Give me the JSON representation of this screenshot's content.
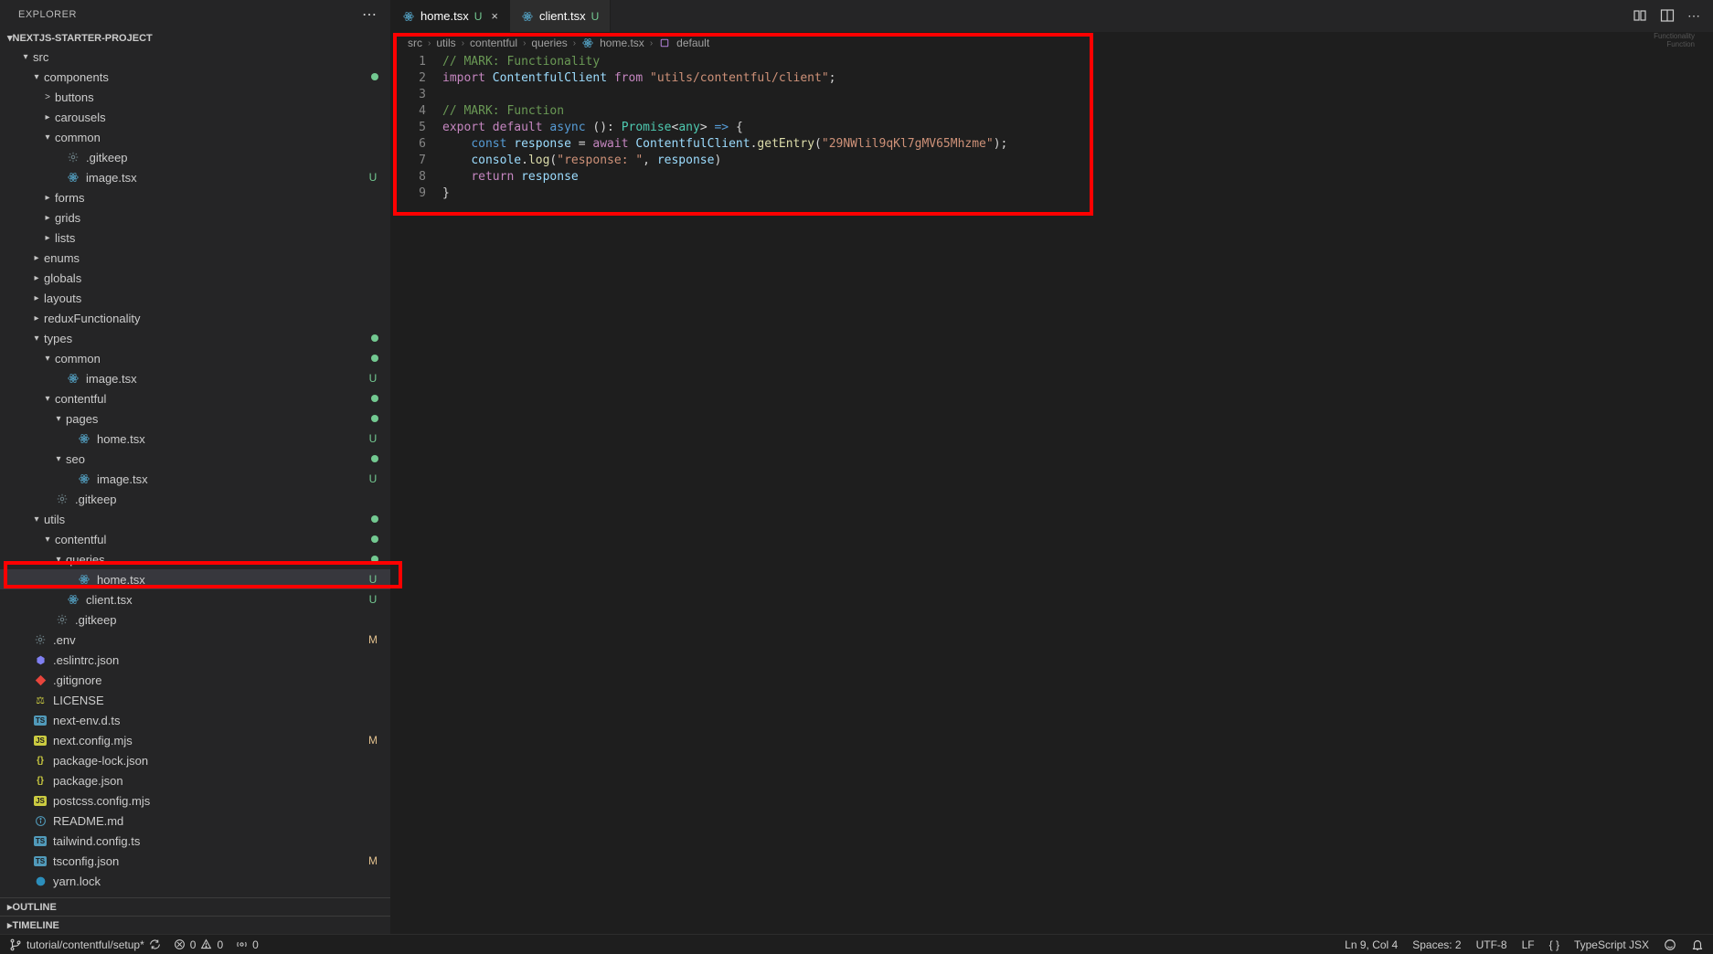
{
  "sidebar": {
    "title": "EXPLORER",
    "project": "NEXTJS-STARTER-PROJECT",
    "outline": "OUTLINE",
    "timeline": "TIMELINE",
    "tree": [
      {
        "type": "folder",
        "label": "src",
        "depth": 1,
        "open": true
      },
      {
        "type": "folder",
        "label": "components",
        "depth": 2,
        "open": true,
        "dot": true
      },
      {
        "type": "folder",
        "label": "buttons",
        "depth": 3,
        "open": false,
        "chev": ">"
      },
      {
        "type": "folder",
        "label": "carousels",
        "depth": 3,
        "open": false
      },
      {
        "type": "folder",
        "label": "common",
        "depth": 3,
        "open": true
      },
      {
        "type": "file",
        "label": ".gitkeep",
        "depth": 4,
        "icon": "gear"
      },
      {
        "type": "file",
        "label": "image.tsx",
        "depth": 4,
        "icon": "react",
        "badge": "U"
      },
      {
        "type": "folder",
        "label": "forms",
        "depth": 3,
        "open": false
      },
      {
        "type": "folder",
        "label": "grids",
        "depth": 3,
        "open": false
      },
      {
        "type": "folder",
        "label": "lists",
        "depth": 3,
        "open": false
      },
      {
        "type": "folder",
        "label": "enums",
        "depth": 2,
        "open": false
      },
      {
        "type": "folder",
        "label": "globals",
        "depth": 2,
        "open": false
      },
      {
        "type": "folder",
        "label": "layouts",
        "depth": 2,
        "open": false
      },
      {
        "type": "folder",
        "label": "reduxFunctionality",
        "depth": 2,
        "open": false
      },
      {
        "type": "folder",
        "label": "types",
        "depth": 2,
        "open": true,
        "dot": true
      },
      {
        "type": "folder",
        "label": "common",
        "depth": 3,
        "open": true,
        "dot": true
      },
      {
        "type": "file",
        "label": "image.tsx",
        "depth": 4,
        "icon": "react",
        "badge": "U"
      },
      {
        "type": "folder",
        "label": "contentful",
        "depth": 3,
        "open": true,
        "dot": true
      },
      {
        "type": "folder",
        "label": "pages",
        "depth": 4,
        "open": true,
        "dot": true
      },
      {
        "type": "file",
        "label": "home.tsx",
        "depth": 5,
        "icon": "react",
        "badge": "U"
      },
      {
        "type": "folder",
        "label": "seo",
        "depth": 4,
        "open": true,
        "dot": true
      },
      {
        "type": "file",
        "label": "image.tsx",
        "depth": 5,
        "icon": "react",
        "badge": "U"
      },
      {
        "type": "file",
        "label": ".gitkeep",
        "depth": 3,
        "icon": "gear"
      },
      {
        "type": "folder",
        "label": "utils",
        "depth": 2,
        "open": true,
        "dot": true
      },
      {
        "type": "folder",
        "label": "contentful",
        "depth": 3,
        "open": true,
        "dot": true
      },
      {
        "type": "folder",
        "label": "queries",
        "depth": 4,
        "open": true,
        "dot": true
      },
      {
        "type": "file",
        "label": "home.tsx",
        "depth": 5,
        "icon": "react",
        "badge": "U",
        "active": true,
        "highlighted": true
      },
      {
        "type": "file",
        "label": "client.tsx",
        "depth": 4,
        "icon": "react",
        "badge": "U"
      },
      {
        "type": "file",
        "label": ".gitkeep",
        "depth": 3,
        "icon": "gear"
      },
      {
        "type": "file",
        "label": ".env",
        "depth": 1,
        "icon": "gear",
        "badge": "M"
      },
      {
        "type": "file",
        "label": ".eslintrc.json",
        "depth": 1,
        "icon": "eslint"
      },
      {
        "type": "file",
        "label": ".gitignore",
        "depth": 1,
        "icon": "git"
      },
      {
        "type": "file",
        "label": "LICENSE",
        "depth": 1,
        "icon": "license"
      },
      {
        "type": "file",
        "label": "next-env.d.ts",
        "depth": 1,
        "icon": "ts"
      },
      {
        "type": "file",
        "label": "next.config.mjs",
        "depth": 1,
        "icon": "js",
        "badge": "M"
      },
      {
        "type": "file",
        "label": "package-lock.json",
        "depth": 1,
        "icon": "json"
      },
      {
        "type": "file",
        "label": "package.json",
        "depth": 1,
        "icon": "json"
      },
      {
        "type": "file",
        "label": "postcss.config.mjs",
        "depth": 1,
        "icon": "js"
      },
      {
        "type": "file",
        "label": "README.md",
        "depth": 1,
        "icon": "info"
      },
      {
        "type": "file",
        "label": "tailwind.config.ts",
        "depth": 1,
        "icon": "ts"
      },
      {
        "type": "file",
        "label": "tsconfig.json",
        "depth": 1,
        "icon": "tsconfig",
        "badge": "M"
      },
      {
        "type": "file",
        "label": "yarn.lock",
        "depth": 1,
        "icon": "yarn"
      }
    ]
  },
  "tabs": [
    {
      "label": "home.tsx",
      "status": "U",
      "active": true
    },
    {
      "label": "client.tsx",
      "status": "U",
      "active": false
    }
  ],
  "breadcrumbs": [
    "src",
    "utils",
    "contentful",
    "queries",
    "home.tsx",
    "default"
  ],
  "code": {
    "lines": [
      {
        "n": 1,
        "html": "<span class='tok-comment'>// MARK: Functionality</span>"
      },
      {
        "n": 2,
        "html": "<span class='tok-keyword'>import</span> <span class='tok-var'>ContentfulClient</span> <span class='tok-keyword'>from</span> <span class='tok-string'>\"utils/contentful/client\"</span>;"
      },
      {
        "n": 3,
        "html": ""
      },
      {
        "n": 4,
        "html": "<span class='tok-comment'>// MARK: Function</span>"
      },
      {
        "n": 5,
        "html": "<span class='tok-keyword'>export</span> <span class='tok-keyword'>default</span> <span class='tok-storage'>async</span> <span class='tok-punct'>()</span>: <span class='tok-type'>Promise</span><span class='tok-punct'>&lt;</span><span class='tok-type'>any</span><span class='tok-punct'>&gt;</span> <span class='tok-storage'>=&gt;</span> <span class='tok-punct'>{</span>"
      },
      {
        "n": 6,
        "html": "    <span class='tok-storage'>const</span> <span class='tok-var'>response</span> = <span class='tok-keyword'>await</span> <span class='tok-var'>ContentfulClient</span>.<span class='tok-func'>getEntry</span>(<span class='tok-string'>\"29NWlil9qKl7gMV65Mhzme\"</span>);"
      },
      {
        "n": 7,
        "html": "    <span class='tok-var'>console</span>.<span class='tok-func'>log</span>(<span class='tok-string'>\"response: \"</span>, <span class='tok-var'>response</span>)"
      },
      {
        "n": 8,
        "html": "    <span class='tok-keyword'>return</span> <span class='tok-var'>response</span>"
      },
      {
        "n": 9,
        "html": "<span class='tok-punct'>}</span>"
      }
    ]
  },
  "minimap": {
    "l1": "Functionality",
    "l2": "Function"
  },
  "status": {
    "branch": "tutorial/contentful/setup*",
    "errors": "0",
    "warnings": "0",
    "ports": "0",
    "ln_col": "Ln 9, Col 4",
    "spaces": "Spaces: 2",
    "encoding": "UTF-8",
    "eol": "LF",
    "lang": "TypeScript JSX"
  }
}
